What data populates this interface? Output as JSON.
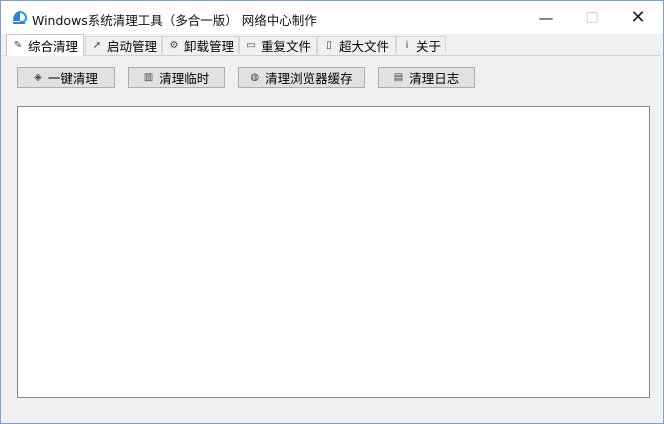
{
  "window": {
    "title": "Windows系统清理工具（多合一版） 网络中心制作",
    "minimize": "—",
    "maximize": "☐",
    "close": "✕"
  },
  "tabs": [
    {
      "label": "综合清理",
      "icon": "brush-icon",
      "glyph": "✎"
    },
    {
      "label": "启动管理",
      "icon": "rocket-icon",
      "glyph": "➚"
    },
    {
      "label": "卸载管理",
      "icon": "gear-icon",
      "glyph": "⚙"
    },
    {
      "label": "重复文件",
      "icon": "folder-icon",
      "glyph": "▭"
    },
    {
      "label": "超大文件",
      "icon": "file-icon",
      "glyph": "▯"
    },
    {
      "label": "关于",
      "icon": "info-icon",
      "glyph": "ⅰ"
    }
  ],
  "toolbar": {
    "oneclick_label": "一键清理",
    "oneclick_glyph": "◈",
    "temp_label": "清理临时",
    "temp_glyph": "▥",
    "browser_label": "清理浏览器缓存",
    "browser_glyph": "◍",
    "log_label": "清理日志",
    "log_glyph": "▤"
  },
  "colors": {
    "window_border": "#7e9ed0",
    "tab_active_bg": "#ffffff",
    "button_bg": "#e1e1e1"
  }
}
